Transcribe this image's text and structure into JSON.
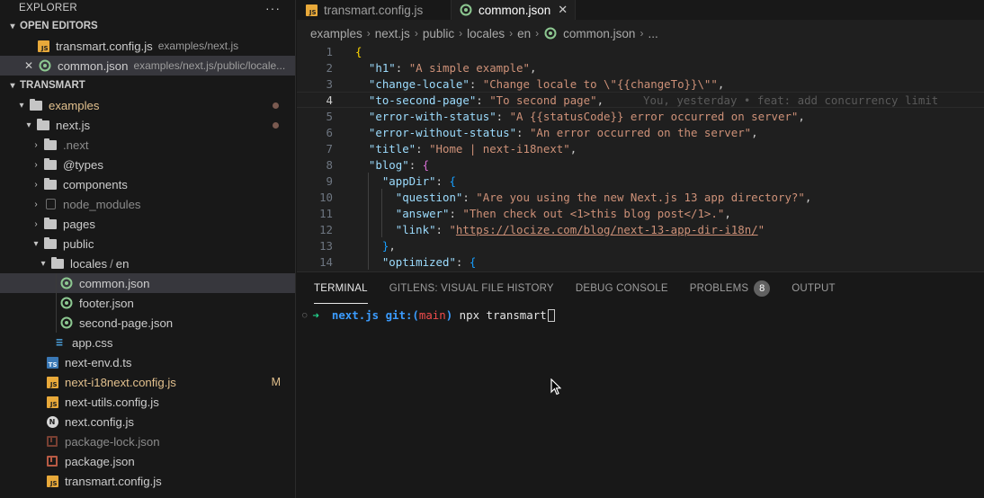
{
  "sidebar": {
    "title": "EXPLORER",
    "more": "···",
    "open_editors_label": "OPEN EDITORS",
    "open_editors": [
      {
        "name": "transmart.config.js",
        "desc": "examples/next.js"
      },
      {
        "name": "common.json",
        "desc": "examples/next.js/public/locale..."
      }
    ],
    "project_label": "TRANSMART",
    "tree": {
      "examples": "examples",
      "nextjs": "next.js",
      "dotnext": ".next",
      "types": "@types",
      "components": "components",
      "node_modules": "node_modules",
      "pages": "pages",
      "public": "public",
      "locales": "locales",
      "locales_sep": "/",
      "en": "en",
      "common": "common.json",
      "footer": "footer.json",
      "second_page": "second-page.json",
      "app_css": "app.css",
      "next_env": "next-env.d.ts",
      "i18n_config": "next-i18next.config.js",
      "i18n_badge": "M",
      "utils_config": "next-utils.config.js",
      "next_config": "next.config.js",
      "pkg_lock": "package-lock.json",
      "pkg": "package.json",
      "transmart_config": "transmart.config.js"
    }
  },
  "tabs": [
    {
      "label": "transmart.config.js"
    },
    {
      "label": "common.json",
      "close": "✕"
    }
  ],
  "breadcrumb": [
    "examples",
    "next.js",
    "public",
    "locales",
    "en",
    "common.json",
    "..."
  ],
  "code": {
    "line_numbers": [
      "1",
      "2",
      "3",
      "4",
      "5",
      "6",
      "7",
      "8",
      "9",
      "10",
      "11",
      "12",
      "13",
      "14"
    ],
    "l1_open": "{",
    "k_h1": "\"h1\"",
    "v_h1": "\"A simple example\"",
    "k_change": "\"change-locale\"",
    "v_change": "\"Change locale to \\\"{{changeTo}}\\\"\"",
    "k_second": "\"to-second-page\"",
    "v_second": "\"To second page\"",
    "blame": "You, yesterday • feat: add concurrency limit",
    "k_err_status": "\"error-with-status\"",
    "v_err_status": "\"A {{statusCode}} error occurred on server\"",
    "k_err_nostatus": "\"error-without-status\"",
    "v_err_nostatus": "\"An error occurred on the server\"",
    "k_title": "\"title\"",
    "v_title": "\"Home | next-i18next\"",
    "k_blog": "\"blog\"",
    "blog_open": "{",
    "k_appdir": "\"appDir\"",
    "appdir_open": "{",
    "k_question": "\"question\"",
    "v_question": "\"Are you using the new Next.js 13 app directory?\"",
    "k_answer": "\"answer\"",
    "v_answer": "\"Then check out <1>this blog post</1>.\"",
    "k_link": "\"link\"",
    "v_link_q": "\"",
    "v_link": "https://locize.com/blog/next-13-app-dir-i18n/",
    "appdir_close": "}",
    "k_optimized": "\"optimized\"",
    "optimized_open": "{"
  },
  "panel": {
    "tabs": [
      "TERMINAL",
      "GITLENS: VISUAL FILE HISTORY",
      "DEBUG CONSOLE",
      "PROBLEMS",
      "OUTPUT"
    ],
    "problems_count": "8",
    "terminal": {
      "dot": "○",
      "arrow": "➜",
      "dir": "next.js",
      "git": "git:(",
      "branch": "main",
      "git_close": ")",
      "command": "npx transmart"
    }
  },
  "colors": {
    "background": "#1f1f1f",
    "sidebar": "#181818",
    "modified": "#e2c08d",
    "json_key": "#9cdcfe",
    "json_string": "#ce9178"
  }
}
